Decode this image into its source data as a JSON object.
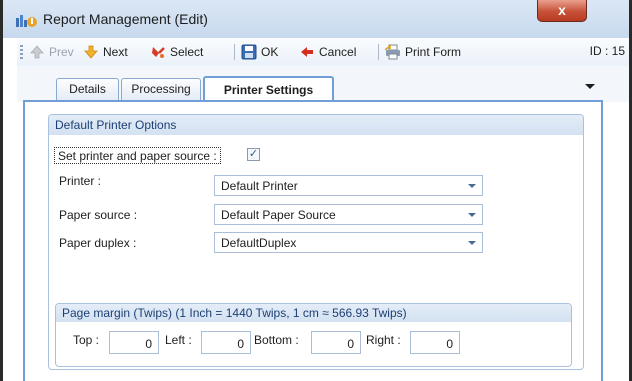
{
  "window": {
    "title": "Report Management (Edit)",
    "close_glyph": "x"
  },
  "toolbar": {
    "prev": "Prev",
    "next": "Next",
    "select": "Select",
    "ok": "OK",
    "cancel": "Cancel",
    "print_form": "Print Form",
    "id_label": "ID : 15",
    "icons": {
      "prev": "up-arrow-icon",
      "next": "down-arrow-icon",
      "select": "select-icon",
      "ok": "save-icon",
      "cancel": "back-arrow-icon",
      "print_form": "printer-icon"
    }
  },
  "tabs": [
    {
      "label": "Details",
      "active": false
    },
    {
      "label": "Processing",
      "active": false
    },
    {
      "label": "Printer Settings",
      "active": true
    }
  ],
  "default_printer_options": {
    "title": "Default Printer Options",
    "set_printer_label": "Set printer and paper source :",
    "set_printer_checked": true,
    "check_glyph": "✓",
    "printer": {
      "label": "Printer :",
      "value": "Default Printer"
    },
    "paper_source": {
      "label": "Paper source :",
      "value": "Default Paper Source"
    },
    "paper_duplex": {
      "label": "Paper duplex :",
      "value": "DefaultDuplex"
    }
  },
  "page_margin": {
    "title": "Page margin (Twips) (1 Inch = 1440 Twips, 1 cm ≈ 566.93 Twips)",
    "top": {
      "label": "Top :",
      "value": "0"
    },
    "left": {
      "label": "Left :",
      "value": "0"
    },
    "bottom": {
      "label": "Bottom :",
      "value": "0"
    },
    "right": {
      "label": "Right :",
      "value": "0"
    }
  },
  "colors": {
    "accent": "#6f9fd6",
    "group_title": "#1d3f75",
    "close": "#c75139"
  }
}
